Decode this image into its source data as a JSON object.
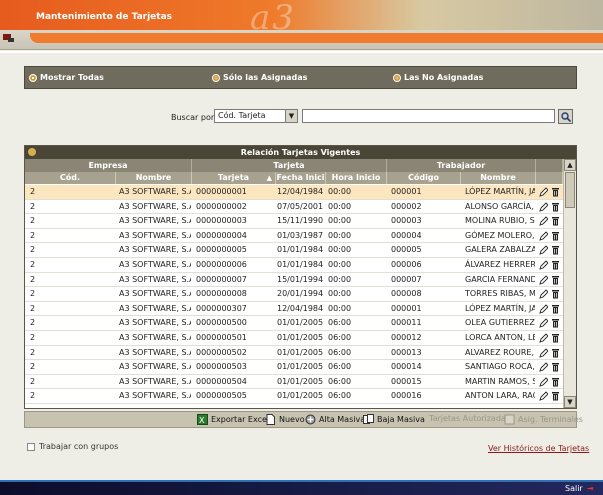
{
  "header": {
    "title": "Mantenimiento de Tarjetas",
    "watermark": "a3"
  },
  "filters": [
    {
      "label": "Mostrar Todas",
      "selected": true
    },
    {
      "label": "Sólo las Asignadas",
      "selected": false
    },
    {
      "label": "Las No Asignadas",
      "selected": false
    }
  ],
  "search": {
    "label": "Buscar por",
    "field_value": "Cód. Tarjeta",
    "query": ""
  },
  "grid": {
    "caption": "Relación Tarjetas Vigentes",
    "groups": {
      "empresa": "Empresa",
      "tarjeta": "Tarjeta",
      "trabajador": "Trabajador"
    },
    "columns": {
      "cod": "Cód.",
      "nombre": "Nombre",
      "tarjeta": "Tarjeta",
      "fecha": "Fecha Inici",
      "hora": "Hora Inicio",
      "codigo": "Código",
      "nombre_trab": "Nombre"
    },
    "rows": [
      {
        "cod": "2",
        "empresa": "A3 SOFTWARE, S.A",
        "tarjeta": "0000000001",
        "fecha": "12/04/1984",
        "hora": "00:00",
        "codigo": "000001",
        "trabajador": "LÓPEZ MARTÍN, JA"
      },
      {
        "cod": "2",
        "empresa": "A3 SOFTWARE, S.A",
        "tarjeta": "0000000002",
        "fecha": "07/05/2001",
        "hora": "00:00",
        "codigo": "000002",
        "trabajador": "ALONSO GARCÍA,"
      },
      {
        "cod": "2",
        "empresa": "A3 SOFTWARE, S.A",
        "tarjeta": "0000000003",
        "fecha": "15/11/1990",
        "hora": "00:00",
        "codigo": "000003",
        "trabajador": "MOLINA RUBIO, S"
      },
      {
        "cod": "2",
        "empresa": "A3 SOFTWARE, S.A",
        "tarjeta": "0000000004",
        "fecha": "01/03/1987",
        "hora": "00:00",
        "codigo": "000004",
        "trabajador": "GÓMEZ MOLERO,"
      },
      {
        "cod": "2",
        "empresa": "A3 SOFTWARE, S.A",
        "tarjeta": "0000000005",
        "fecha": "01/01/1984",
        "hora": "00:00",
        "codigo": "000005",
        "trabajador": "GALERA ZABALZA,"
      },
      {
        "cod": "2",
        "empresa": "A3 SOFTWARE, S.A",
        "tarjeta": "0000000006",
        "fecha": "01/01/1984",
        "hora": "00:00",
        "codigo": "000006",
        "trabajador": "ÁLVAREZ HERRERA"
      },
      {
        "cod": "2",
        "empresa": "A3 SOFTWARE, S.A",
        "tarjeta": "0000000007",
        "fecha": "15/01/1994",
        "hora": "00:00",
        "codigo": "000007",
        "trabajador": "GARCIA FERNAND"
      },
      {
        "cod": "2",
        "empresa": "A3 SOFTWARE, S.A",
        "tarjeta": "0000000008",
        "fecha": "20/01/1994",
        "hora": "00:00",
        "codigo": "000008",
        "trabajador": "TORRES RIBAS, MI"
      },
      {
        "cod": "2",
        "empresa": "A3 SOFTWARE, S.A",
        "tarjeta": "0000000307",
        "fecha": "12/04/1984",
        "hora": "00:00",
        "codigo": "000001",
        "trabajador": "LÓPEZ MARTÍN, JA"
      },
      {
        "cod": "2",
        "empresa": "A3 SOFTWARE, S.A",
        "tarjeta": "0000000500",
        "fecha": "01/01/2005",
        "hora": "06:00",
        "codigo": "000011",
        "trabajador": "OLEA GUTIERREZ,"
      },
      {
        "cod": "2",
        "empresa": "A3 SOFTWARE, S.A",
        "tarjeta": "0000000501",
        "fecha": "01/01/2005",
        "hora": "06:00",
        "codigo": "000012",
        "trabajador": "LORCA ANTON, LE"
      },
      {
        "cod": "2",
        "empresa": "A3 SOFTWARE, S.A",
        "tarjeta": "0000000502",
        "fecha": "01/01/2005",
        "hora": "06:00",
        "codigo": "000013",
        "trabajador": "ALVAREZ ROURE,"
      },
      {
        "cod": "2",
        "empresa": "A3 SOFTWARE, S.A",
        "tarjeta": "0000000503",
        "fecha": "01/01/2005",
        "hora": "06:00",
        "codigo": "000014",
        "trabajador": "SANTIAGO ROCA,"
      },
      {
        "cod": "2",
        "empresa": "A3 SOFTWARE, S.A",
        "tarjeta": "0000000504",
        "fecha": "01/01/2005",
        "hora": "06:00",
        "codigo": "000015",
        "trabajador": "MARTIN RAMOS, S"
      },
      {
        "cod": "2",
        "empresa": "A3 SOFTWARE, S.A",
        "tarjeta": "0000000505",
        "fecha": "01/01/2005",
        "hora": "06:00",
        "codigo": "000016",
        "trabajador": "ANTON LARA, RAQ"
      }
    ]
  },
  "toolbar": {
    "exportar": "Exportar Excel",
    "nuevo": "Nuevo",
    "alta": "Alta Masiva",
    "baja": "Baja Masiva",
    "autorizadas": "Tarjetas Autorizadas",
    "asig": "Asig. Terminales"
  },
  "footer_opts": {
    "grupos": "Trabajar con grupos",
    "historicos": "Ver Históricos de Tarjetas"
  },
  "footer": {
    "salir": "Salir"
  },
  "colors": {
    "accent": "#ef7a2a",
    "header_dark": "#4a4637",
    "selected_row": "#fbe6bf",
    "link": "#8b1a1a"
  }
}
